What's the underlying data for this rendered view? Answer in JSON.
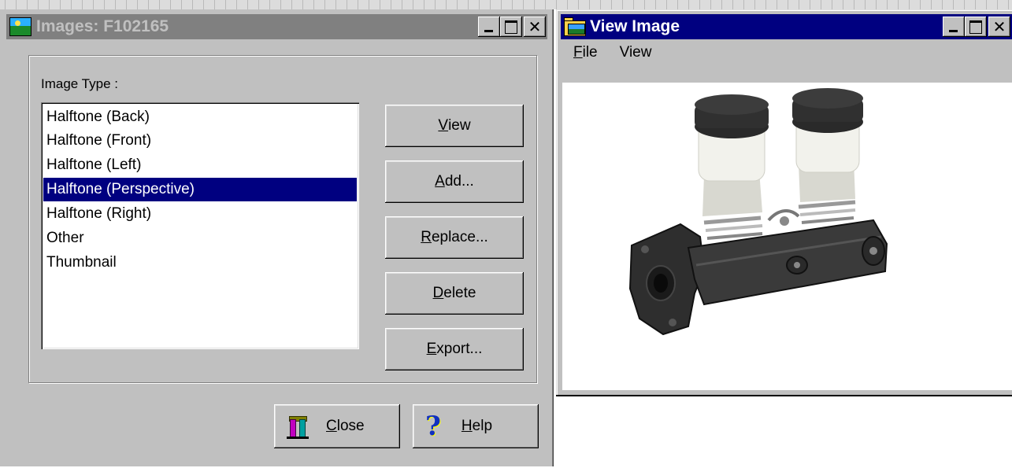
{
  "images_window": {
    "title": "Images:  F102165",
    "image_type_label": "Image Type :",
    "image_types": [
      "Halftone (Back)",
      "Halftone (Front)",
      "Halftone (Left)",
      "Halftone (Perspective)",
      "Halftone (Right)",
      "Other",
      "Thumbnail"
    ],
    "selected_index": 3,
    "buttons": {
      "view": {
        "mnemonic": "V",
        "rest": "iew"
      },
      "add": {
        "mnemonic": "A",
        "rest": "dd..."
      },
      "replace": {
        "mnemonic": "R",
        "rest": "eplace..."
      },
      "delete": {
        "mnemonic": "D",
        "rest": "elete"
      },
      "export": {
        "mnemonic": "E",
        "rest": "xport..."
      },
      "close": {
        "mnemonic": "C",
        "rest": "lose"
      },
      "help": {
        "mnemonic": "H",
        "rest": "elp"
      }
    },
    "icons": [
      "window-app-icon",
      "close-door-icon",
      "help-question-icon"
    ]
  },
  "view_window": {
    "title": "View Image",
    "menu": {
      "file": {
        "mnemonic": "F",
        "rest": "ile"
      },
      "view": "View"
    },
    "image_subject": "brake-master-cylinder-photo",
    "icons": [
      "folder-picture-icon"
    ]
  },
  "colors": {
    "active_title": "#000080",
    "inactive_title": "#808080",
    "face": "#c0c0c0",
    "selection": "#000080"
  }
}
